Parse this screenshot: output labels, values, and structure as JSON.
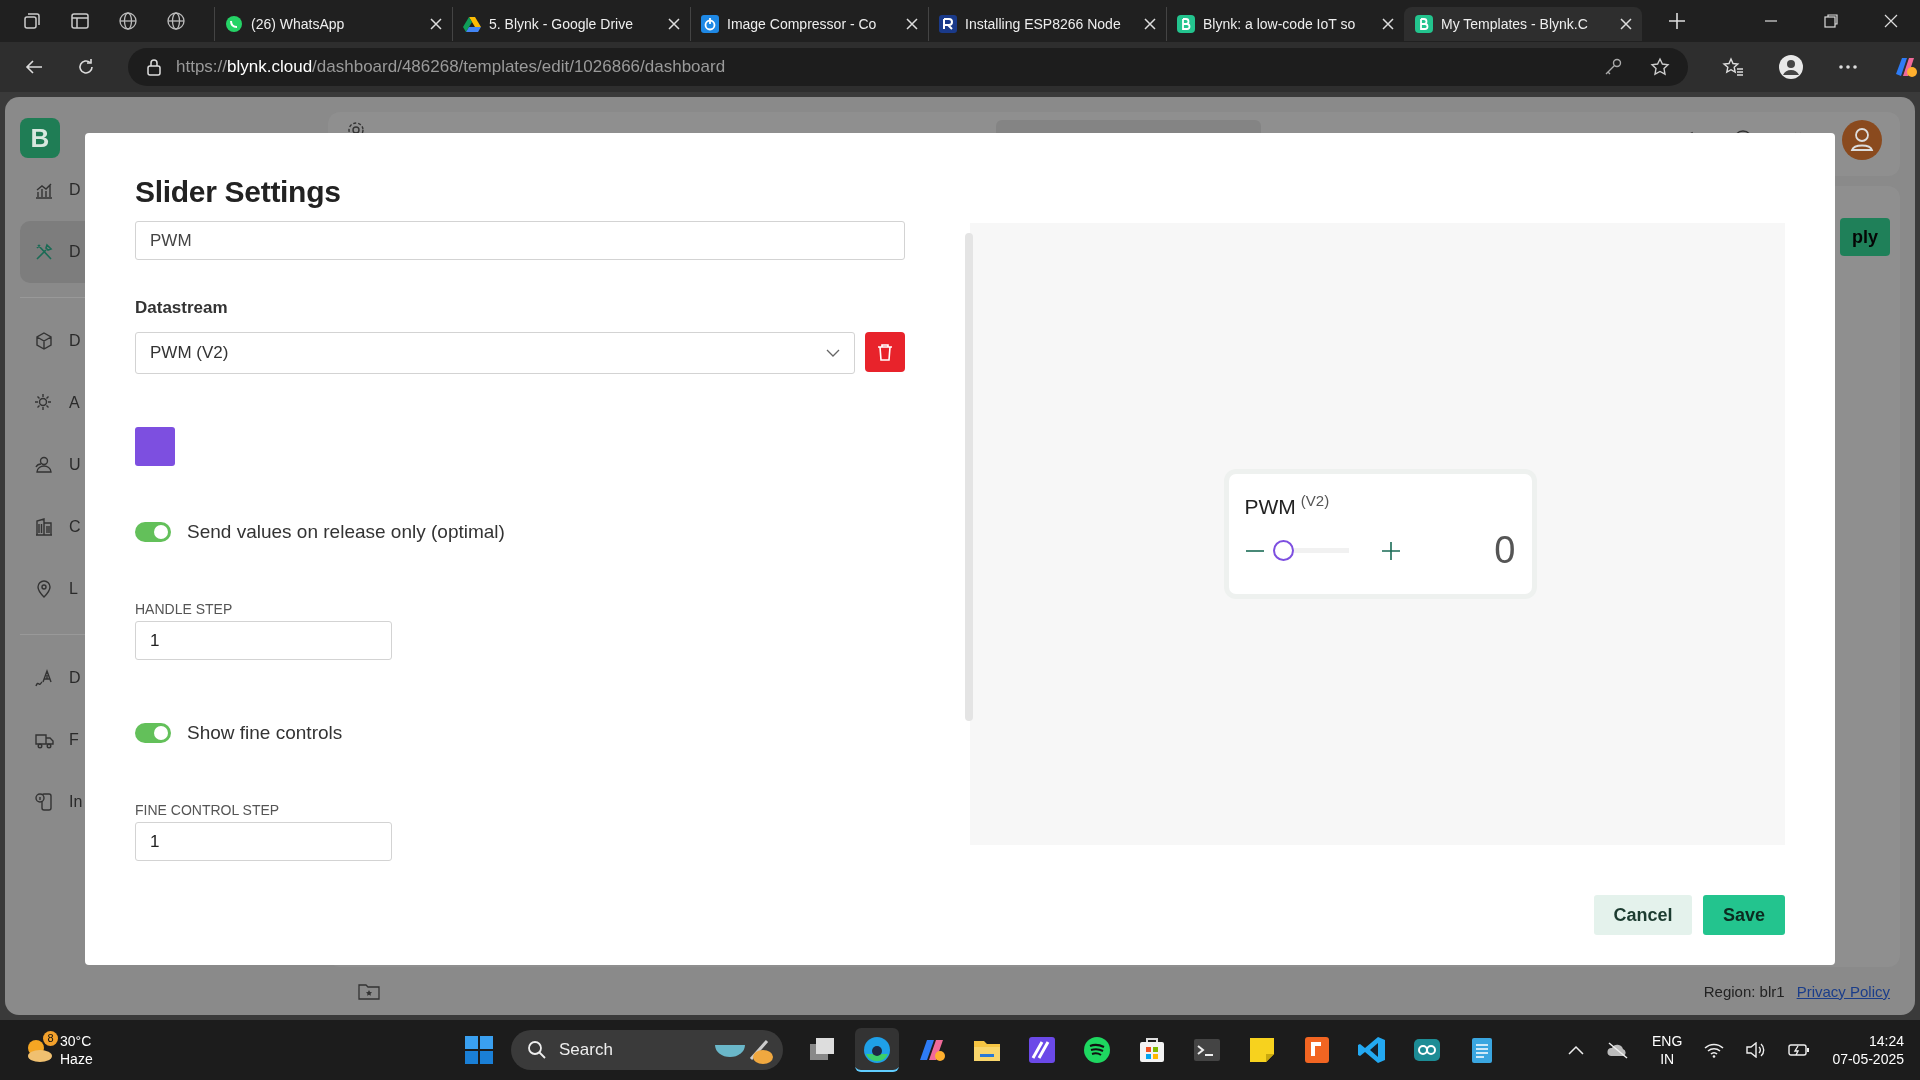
{
  "browser": {
    "tabs": [
      {
        "title": "(26) WhatsApp",
        "kind": "whatsapp",
        "selected": false
      },
      {
        "title": "5. Blynk - Google Drive",
        "kind": "drive",
        "selected": false
      },
      {
        "title": "Image Compressor - Co",
        "kind": "power",
        "selected": false
      },
      {
        "title": "Installing ESP8266 Node",
        "kind": "letter",
        "selected": false
      },
      {
        "title": "Blynk: a low-code IoT so",
        "kind": "blynk",
        "selected": false
      },
      {
        "title": "My Templates - Blynk.C",
        "kind": "blynk",
        "selected": true
      }
    ],
    "url": {
      "scheme": "https://",
      "host": "blynk.cloud",
      "path": "/dashboard/486268/templates/edit/1026866/dashboard"
    }
  },
  "console": {
    "logo": "B",
    "sidebar": [
      {
        "label": "D",
        "kind": "chart",
        "selected": false
      },
      {
        "label": "D",
        "kind": "tools",
        "selected": true
      },
      {
        "label": "D",
        "kind": "cube",
        "selected": false
      },
      {
        "label": "A",
        "kind": "sun",
        "selected": false
      },
      {
        "label": "U",
        "kind": "users",
        "selected": false
      },
      {
        "label": "C",
        "kind": "building",
        "selected": false
      },
      {
        "label": "L",
        "kind": "pin",
        "selected": false
      },
      {
        "label": "D",
        "kind": "signal",
        "selected": false
      },
      {
        "label": "F",
        "kind": "truck",
        "selected": false
      },
      {
        "label": "In",
        "kind": "info",
        "selected": false
      }
    ],
    "apply_button": "ply",
    "region": "Region: blr1",
    "privacy_link": "Privacy Policy"
  },
  "modal": {
    "title": "Slider Settings",
    "name": "PWM",
    "datastream_label": "Datastream",
    "datastream": "PWM (V2)",
    "color": "#7d4fe0",
    "settings": [
      {
        "kind": "toggle",
        "label": "Send values on release only (optimal)",
        "on": true
      },
      {
        "kind": "number",
        "label": "HANDLE STEP",
        "value": "1"
      },
      {
        "kind": "toggle",
        "label": "Show fine controls",
        "on": true
      },
      {
        "kind": "number",
        "label": "FINE CONTROL STEP",
        "value": "1"
      }
    ],
    "preview": {
      "title": "PWM",
      "pin": "(V2)",
      "value": "0",
      "level": 0
    },
    "buttons": [
      {
        "label": "Cancel",
        "kind": "secondary"
      },
      {
        "label": "Save",
        "kind": "primary"
      }
    ]
  },
  "taskbar": {
    "weather": {
      "temperature": "30°C",
      "condition": "Haze",
      "badge": "8"
    },
    "search": {
      "placeholder": "Search"
    },
    "apps": [
      {
        "kind": "taskview",
        "active": false
      },
      {
        "kind": "edge",
        "active": true
      },
      {
        "kind": "copilot",
        "active": false
      },
      {
        "kind": "folder",
        "active": false
      },
      {
        "kind": "editor",
        "active": false
      },
      {
        "kind": "spotify",
        "active": false
      },
      {
        "kind": "store",
        "active": false
      },
      {
        "kind": "terminal",
        "active": false
      },
      {
        "kind": "notes",
        "active": false
      },
      {
        "kind": "square",
        "active": false
      },
      {
        "kind": "vscode",
        "active": false
      },
      {
        "kind": "arduino",
        "active": false
      },
      {
        "kind": "notepad",
        "active": false
      }
    ],
    "language": "ENG",
    "region": "IN",
    "time": "14:24",
    "date": "07-05-2025"
  }
}
